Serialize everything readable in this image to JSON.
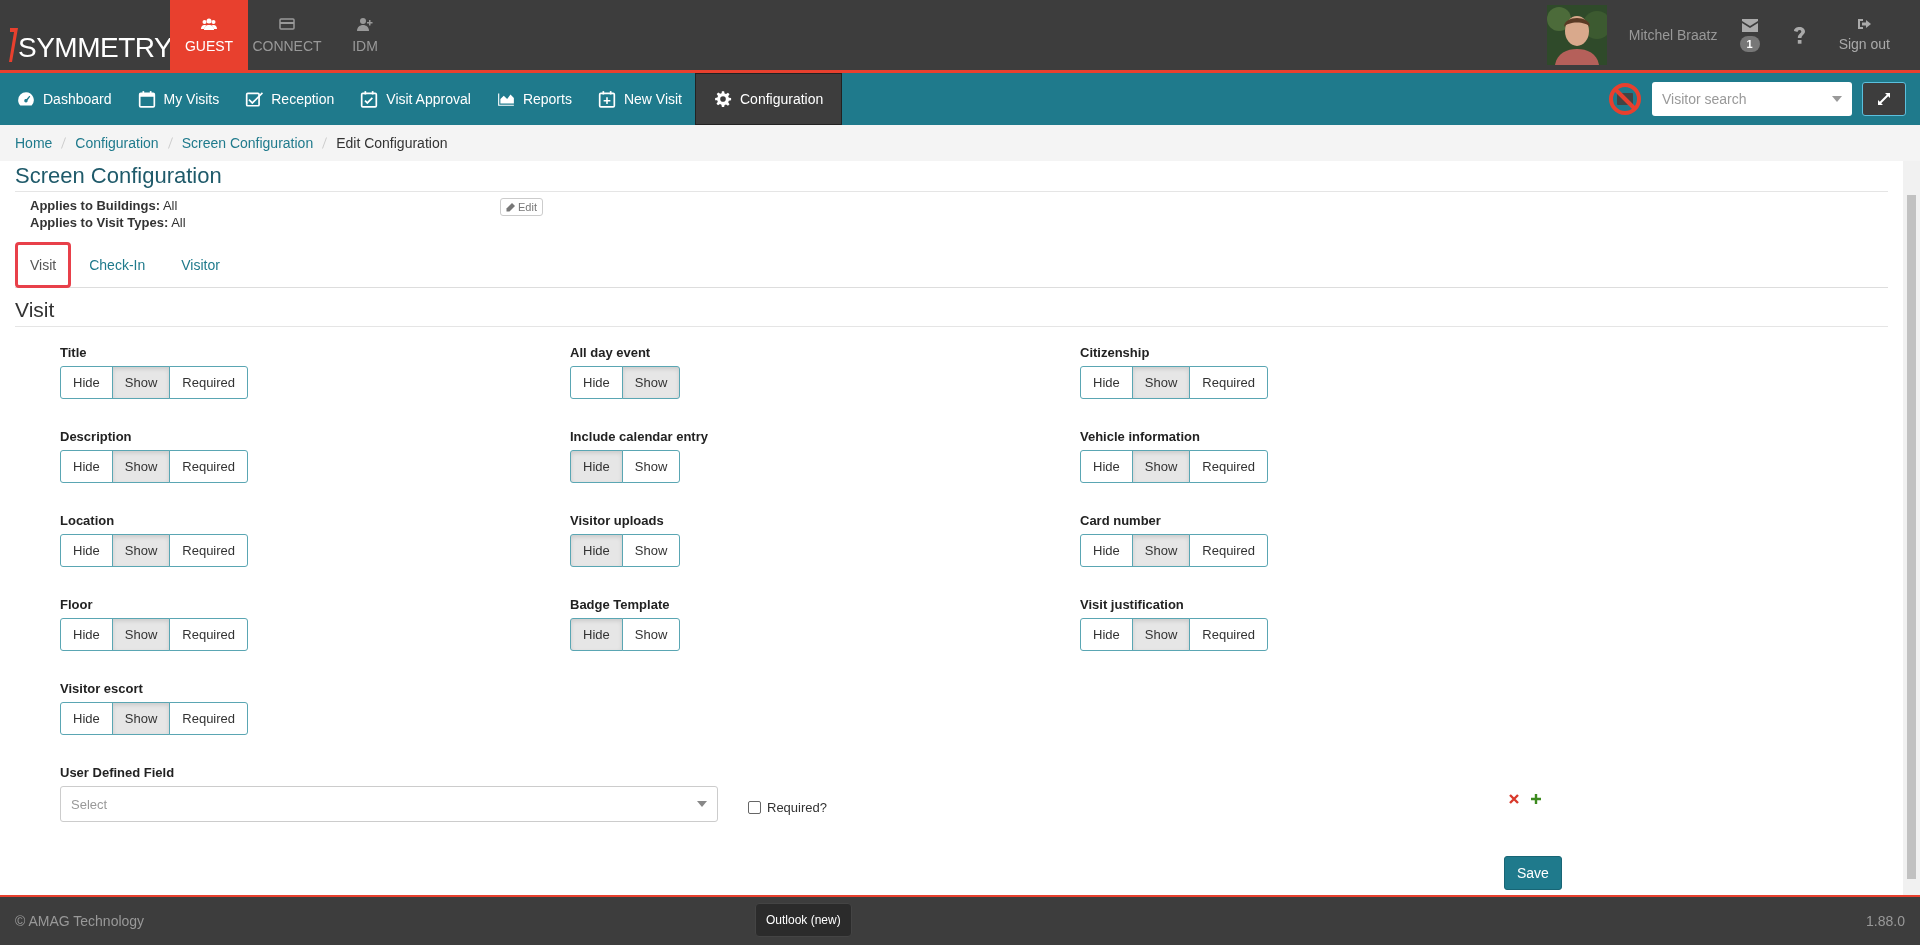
{
  "logo": "SYMMETRY",
  "app_tabs": [
    {
      "label": "GUEST",
      "selected": true
    },
    {
      "label": "CONNECT",
      "selected": false
    },
    {
      "label": "IDM",
      "selected": false
    }
  ],
  "user": {
    "name": "Mitchel Braatz",
    "messages_count": "1",
    "sign_out": "Sign out"
  },
  "nav": [
    {
      "label": "Dashboard",
      "selected": false
    },
    {
      "label": "My Visits",
      "selected": false
    },
    {
      "label": "Reception",
      "selected": false
    },
    {
      "label": "Visit Approval",
      "selected": false
    },
    {
      "label": "Reports",
      "selected": false
    },
    {
      "label": "New Visit",
      "selected": false
    },
    {
      "label": "Configuration",
      "selected": true
    }
  ],
  "visitor_search": {
    "placeholder": "Visitor search"
  },
  "breadcrumb": [
    "Home",
    "Configuration",
    "Screen Configuration",
    "Edit Configuration"
  ],
  "page_title": "Screen Configuration",
  "applies": [
    {
      "label": "Applies to Buildings:",
      "value": "All"
    },
    {
      "label": "Applies to Visit Types:",
      "value": "All"
    }
  ],
  "edit_button": "Edit",
  "tabs": [
    {
      "label": "Visit",
      "selected": true
    },
    {
      "label": "Check-In",
      "selected": false
    },
    {
      "label": "Visitor",
      "selected": false
    }
  ],
  "section_title": "Visit",
  "columns": [
    [
      {
        "label": "Title",
        "options": [
          {
            "label": "Hide",
            "selected": false
          },
          {
            "label": "Show",
            "selected": true
          },
          {
            "label": "Required",
            "selected": false
          }
        ]
      },
      {
        "label": "Description",
        "options": [
          {
            "label": "Hide",
            "selected": false
          },
          {
            "label": "Show",
            "selected": true
          },
          {
            "label": "Required",
            "selected": false
          }
        ]
      },
      {
        "label": "Location",
        "options": [
          {
            "label": "Hide",
            "selected": false
          },
          {
            "label": "Show",
            "selected": true
          },
          {
            "label": "Required",
            "selected": false
          }
        ]
      },
      {
        "label": "Floor",
        "options": [
          {
            "label": "Hide",
            "selected": false
          },
          {
            "label": "Show",
            "selected": true
          },
          {
            "label": "Required",
            "selected": false
          }
        ]
      },
      {
        "label": "Visitor escort",
        "options": [
          {
            "label": "Hide",
            "selected": false
          },
          {
            "label": "Show",
            "selected": true
          },
          {
            "label": "Required",
            "selected": false
          }
        ]
      }
    ],
    [
      {
        "label": "All day event",
        "options": [
          {
            "label": "Hide",
            "selected": false
          },
          {
            "label": "Show",
            "selected": true
          }
        ]
      },
      {
        "label": "Include calendar entry",
        "options": [
          {
            "label": "Hide",
            "selected": true
          },
          {
            "label": "Show",
            "selected": false
          }
        ]
      },
      {
        "label": "Visitor uploads",
        "options": [
          {
            "label": "Hide",
            "selected": true
          },
          {
            "label": "Show",
            "selected": false
          }
        ]
      },
      {
        "label": "Badge Template",
        "options": [
          {
            "label": "Hide",
            "selected": true
          },
          {
            "label": "Show",
            "selected": false
          }
        ]
      }
    ],
    [
      {
        "label": "Citizenship",
        "options": [
          {
            "label": "Hide",
            "selected": false
          },
          {
            "label": "Show",
            "selected": true
          },
          {
            "label": "Required",
            "selected": false
          }
        ]
      },
      {
        "label": "Vehicle information",
        "options": [
          {
            "label": "Hide",
            "selected": false
          },
          {
            "label": "Show",
            "selected": true
          },
          {
            "label": "Required",
            "selected": false
          }
        ]
      },
      {
        "label": "Card number",
        "options": [
          {
            "label": "Hide",
            "selected": false
          },
          {
            "label": "Show",
            "selected": true
          },
          {
            "label": "Required",
            "selected": false
          }
        ]
      },
      {
        "label": "Visit justification",
        "options": [
          {
            "label": "Hide",
            "selected": false
          },
          {
            "label": "Show",
            "selected": true
          },
          {
            "label": "Required",
            "selected": false
          }
        ]
      }
    ]
  ],
  "user_defined_field": {
    "label": "User Defined Field",
    "placeholder": "Select",
    "required_label": "Required?",
    "required_checked": false
  },
  "save_button": "Save",
  "footer": {
    "copyright": "© AMAG Technology",
    "version": "1.88.0"
  },
  "tooltip": "Outlook (new)"
}
